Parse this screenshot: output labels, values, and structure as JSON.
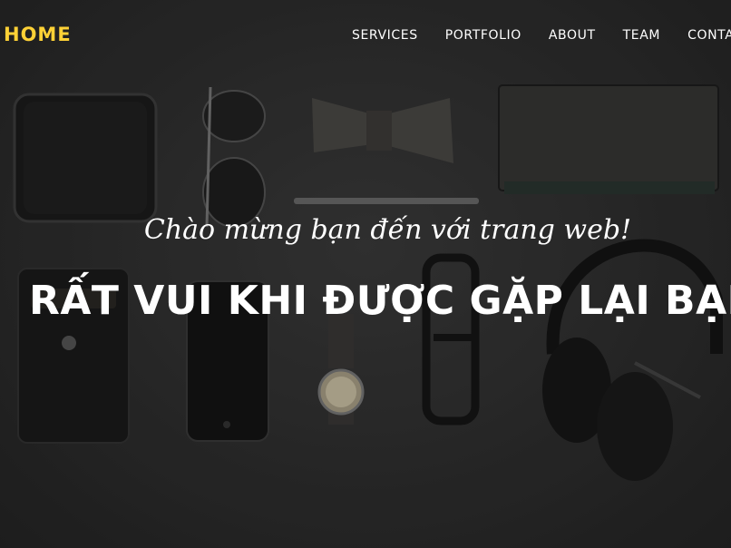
{
  "navbar": {
    "brand": "HOME",
    "links": [
      "SERVICES",
      "PORTFOLIO",
      "ABOUT",
      "TEAM",
      "CONTACT"
    ]
  },
  "hero": {
    "lead": "Chào mừng bạn đến với trang web!",
    "heading": "RẤT VUI KHI ĐƯỢC GẶP LẠI BẠN"
  },
  "colors": {
    "brand": "#fed136",
    "text": "#ffffff",
    "background": "#2e2e2e"
  }
}
